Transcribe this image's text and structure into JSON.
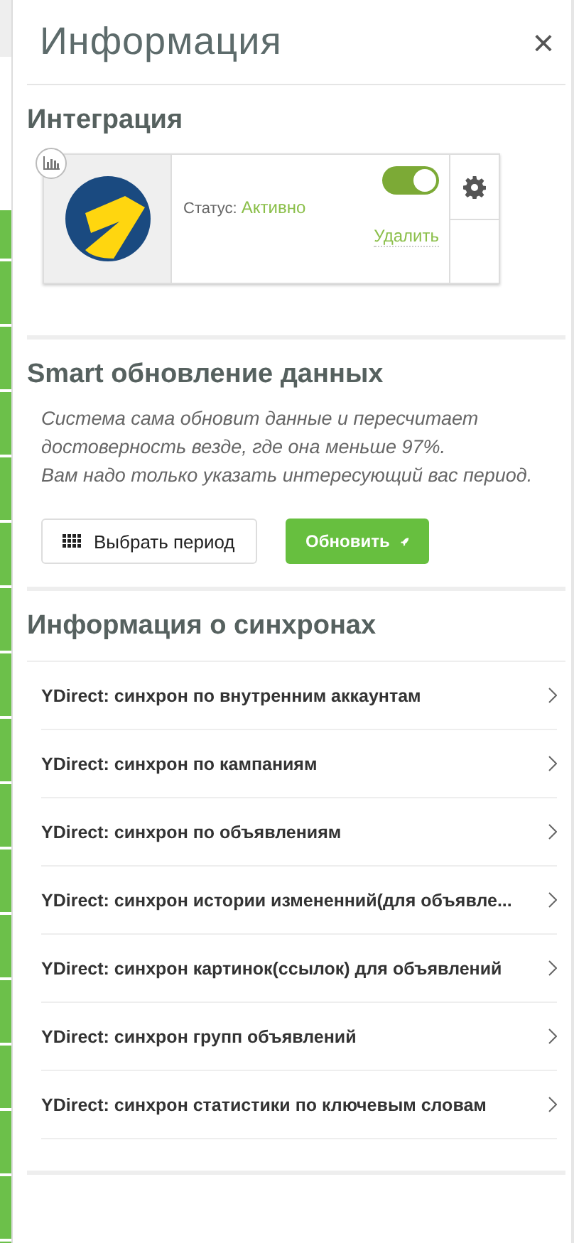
{
  "panel": {
    "title": "Информация",
    "close": "×"
  },
  "integration": {
    "heading": "Интеграция",
    "status_label": "Статус:",
    "status_value": "Активно",
    "toggle": {
      "on": true
    },
    "delete": "Удалить"
  },
  "smart_update": {
    "heading": "Smart обновление данных",
    "description": "Система сама обновит данные и пересчитает достоверность везде, где она меньше 97%.\nВам надо только указать интересующий вас период.",
    "buttons": [
      {
        "label": "Выбрать период",
        "kind": "outline"
      },
      {
        "label": "Обновить",
        "kind": "primary"
      }
    ]
  },
  "syncs": {
    "heading": "Информация о синхронах",
    "items": [
      {
        "label": "YDirect: синхрон по внутренним аккаунтам"
      },
      {
        "label": "YDirect: синхрон по кампаниям"
      },
      {
        "label": "YDirect: синхрон по объявлениям"
      },
      {
        "label": "YDirect: синхрон истории измененний(для объявле..."
      },
      {
        "label": "YDirect: синхрон картинок(ссылок) для объявлений"
      },
      {
        "label": "YDirect: синхрон групп объявлений"
      },
      {
        "label": "YDirect: синхрон статистики по ключевым словам"
      }
    ]
  }
}
